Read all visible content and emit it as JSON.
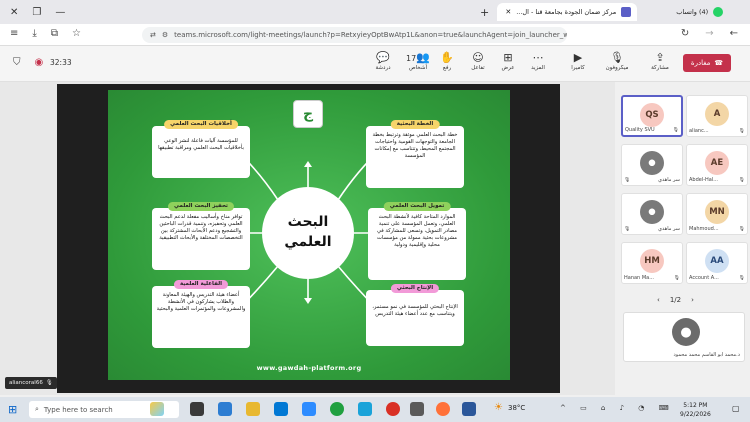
{
  "browser": {
    "tab_active_title": "مركز ضمان الجودة بجامعة قنا - ال...",
    "tab_second_title": "(4) واتساب",
    "new_tab": "+",
    "url": "teams.microsoft.com/light-meetings/launch?p=RetxyieyOptBwAtp1L&anon=true&launchAgent=join_launcher_web&la..."
  },
  "meeting": {
    "timer": "32:33",
    "leave_label": "مغادرة",
    "tools": [
      {
        "label": "مشاركة",
        "icon": "share-icon"
      },
      {
        "label": "كاميرا",
        "icon": "camera-icon"
      },
      {
        "label": "ميكروفون",
        "icon": "mic-icon"
      },
      {
        "label": "المزيد",
        "icon": "more-icon"
      },
      {
        "label": "عرض",
        "icon": "view-icon"
      },
      {
        "label": "تفاعل",
        "icon": "react-icon"
      },
      {
        "label": "رفع",
        "icon": "raise-hand-icon"
      },
      {
        "label": "أشخاص",
        "icon": "people-icon",
        "count": "17"
      },
      {
        "label": "دردشة",
        "icon": "chat-icon"
      }
    ]
  },
  "slide": {
    "center_title_line1": "البحث",
    "center_title_line2": "العلمي",
    "website": "www.gawdah-platform.org",
    "cards": [
      {
        "title": "أخلاقيات البحث العلمي",
        "text": "للمؤسسة آليات فاعلة لنشر الوعي بأخلاقيات البحث العلمي ومراقبة تطبيقها",
        "color": "#f6d46a"
      },
      {
        "title": "الخطة البحثية",
        "text": "خطة البحث العلمي موثقة وترتبط بخطة الجامعة والتوجهات القومية واحتياجات المجتمع المحيط، وتتناسب مع إمكانات المؤسسة",
        "color": "#f6d46a"
      },
      {
        "title": "تحفيز البحث العلمي",
        "text": "توافر مناخ وأساليب مفعلة لدعم البحث العلمي وتحفيزه، وتنمية قدرات الباحثين والتشجيع ودعم الأبحاث المشتركة بين التخصصات المختلفة والأبحاث التطبيقية",
        "color": "#8fd15c"
      },
      {
        "title": "تمويل البحث العلمي",
        "text": "الموارد المتاحة كافية لأنشطة البحث العلمي، وتعمل المؤسسة على تنمية مصادر التمويل، وتسعى للمشاركة في مشروعات بحثية ممولة من مؤسسات محلية وإقليمية ودولية",
        "color": "#8fd15c"
      },
      {
        "title": "الفاعلية العلمية",
        "text": "أعضاء هيئة التدريس والهيئة المعاونة والطلاب يشاركون في الأنشطة والمشروعات والمؤتمرات العلمية والبحثية",
        "color": "#f29ad8"
      },
      {
        "title": "الإنتاج البحثي",
        "text": "الإنتاج البحثي للمؤسسة في نمو مستمر، ويتناسب مع عدد أعضاء هيئة التدريس",
        "color": "#f29ad8"
      }
    ]
  },
  "presenter_name": "aliancoral66",
  "participants": [
    {
      "initials": "QS",
      "name": "Quality SVU",
      "color": "#f7c8c0",
      "active": true
    },
    {
      "initials": "A",
      "name": "alianc...",
      "color": "#f3d6a6",
      "active": false
    },
    {
      "initials": "",
      "name": "سر ماهدي",
      "color": "#7a7a7a",
      "active": false
    },
    {
      "initials": "AE",
      "name": "Abdel-Hal...",
      "color": "#f7c8c0",
      "active": false
    },
    {
      "initials": "",
      "name": "سر ماهدي",
      "color": "#7a7a7a",
      "active": false
    },
    {
      "initials": "MN",
      "name": "Mahmoud...",
      "color": "#f3d6a6",
      "active": false
    },
    {
      "initials": "HM",
      "name": "Hanan Ma...",
      "color": "#f7c8c0",
      "active": false
    },
    {
      "initials": "AA",
      "name": "Account A...",
      "color": "#cfe0f3",
      "active": false
    }
  ],
  "pager": "1/2",
  "big_participant": "د.محمد ابو القاسم محمد محمود",
  "taskbar": {
    "search_placeholder": "Type here to search",
    "temperature": "38°C",
    "time": "5:12 PM",
    "date": "9/22/2026"
  }
}
